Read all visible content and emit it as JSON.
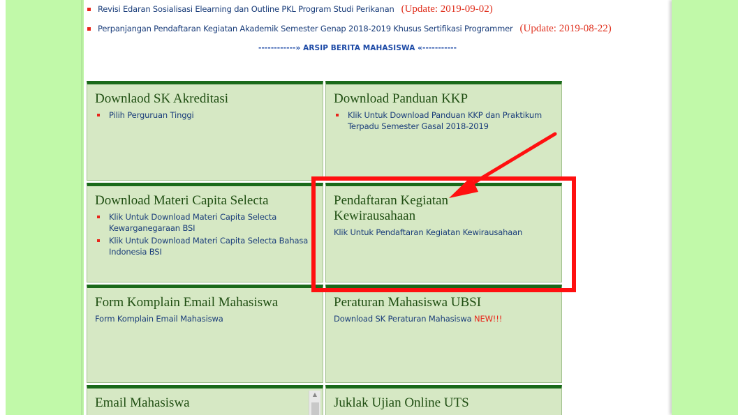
{
  "news": [
    {
      "text": "Revisi Edaran Sosialisasi Elearning dan Outline PKL Program Studi Perikanan",
      "update": "(Update: 2019-09-02)"
    },
    {
      "text": "Perpanjangan Pendaftaran Kegiatan Akademik Semester Genap 2018-2019 Khusus Sertifikasi Programmer",
      "update": "(Update: 2019-08-22)"
    }
  ],
  "archive_link": "------------» ARSIP BERITA MAHASISWA «-----------",
  "panels": {
    "sk_akreditasi": {
      "title": "Downlaod SK Akreditasi",
      "items": [
        "Pilih Perguruan Tinggi"
      ]
    },
    "panduan_kkp": {
      "title": "Download Panduan KKP",
      "items": [
        "Klik Untuk Download Panduan KKP dan Praktikum Terpadu Semester Gasal 2018-2019"
      ]
    },
    "capita_selecta": {
      "title": "Download Materi Capita Selecta",
      "items": [
        "Klik Untuk Download Materi Capita Selecta Kewarganegaraan BSI",
        "Klik Untuk Download Materi Capita Selecta Bahasa Indonesia BSI"
      ]
    },
    "kewirausahaan": {
      "title": "Pendaftaran Kegiatan Kewirausahaan",
      "link": "Klik Untuk Pendaftaran Kegiatan Kewirausahaan"
    },
    "komplain_email": {
      "title": "Form Komplain Email Mahasiswa",
      "link": "Form Komplain Email Mahasiswa"
    },
    "peraturan": {
      "title": "Peraturan Mahasiswa UBSI",
      "link": "Download SK Peraturan Mahasiswa",
      "badge": "NEW!!!"
    },
    "email_mahasiswa": {
      "title": "Email Mahasiswa"
    },
    "juklak_uts": {
      "title": "Juklak Ujian Online UTS"
    }
  },
  "colors": {
    "page_side_green": "#c1f9a9",
    "panel_bg": "#d6e8c4",
    "panel_border_top": "#1a6a1a",
    "link_blue": "#1a3d7a",
    "update_red": "#e0301e",
    "annotation_red": "#ff1010"
  }
}
